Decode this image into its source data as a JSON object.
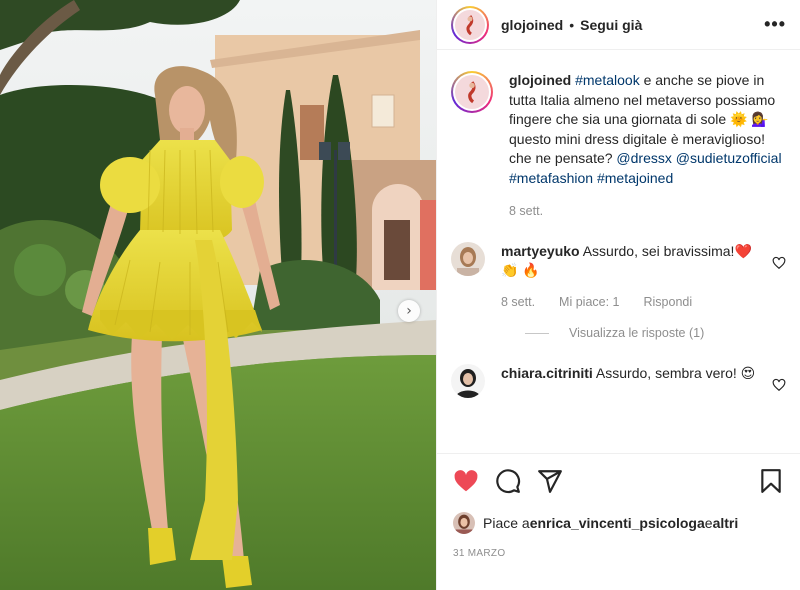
{
  "post": {
    "author": "glojoined",
    "separator": "•",
    "follow_label": "Segui già",
    "more_icon": "more-options-icon",
    "caption": {
      "username": "glojoined",
      "hashtag_metalook": "#metalook",
      "text_1": " e anche se piove in tutta Italia almeno nel metaverso possiamo fingere che sia una giornata di sole ",
      "emoji_1": "🌞",
      "emoji_2": "💁‍♀️",
      "text_2": " questo mini dress digitale è meraviglioso! che ne pensate? ",
      "mention_dressx": "@dressx",
      "mention_sudietuz": "@sudietuzofficial",
      "hashtag_metafashion": "#metafashion",
      "hashtag_metajoined": "#metajoined",
      "time": "8 sett."
    },
    "comments": [
      {
        "username": "martyeyuko",
        "text": " Assurdo, sei bravissima!",
        "emojis": "❤️ 👏 🔥",
        "time": "8 sett.",
        "likes": "Mi piace: 1",
        "reply": "Rispondi"
      },
      {
        "username": "chiara.citriniti",
        "text": " Assurdo, sembra vero! ",
        "emojis": "😍"
      }
    ],
    "view_replies": "Visualizza le risposte (1)",
    "liked_by_prefix": "Piace a ",
    "liked_by_user": "enrica_vincenti_psicologa",
    "liked_by_suffix": " e ",
    "liked_by_others": "altri",
    "date": "31 marzo"
  },
  "icons": {
    "like": "heart-filled-icon",
    "comment": "comment-icon",
    "share": "share-icon",
    "save": "bookmark-icon",
    "carousel_next": "chevron-right-icon"
  },
  "colors": {
    "like_red": "#ed4956",
    "link_blue": "#00376b",
    "muted": "#8e8e8e",
    "dress_yellow": "#e9d33a"
  }
}
